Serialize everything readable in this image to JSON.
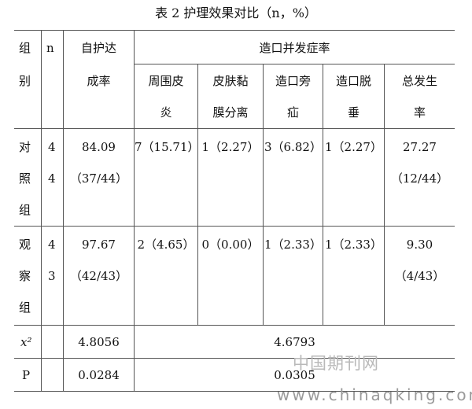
{
  "caption": "表 2 护理效果对比（n，%）",
  "header": {
    "group": [
      "组",
      "别"
    ],
    "n": "n",
    "self_care": [
      "自护达",
      "成率"
    ],
    "complication_group": "造口并发症率",
    "sub": [
      [
        "周围皮",
        "炎"
      ],
      [
        "皮肤黏",
        "膜分离"
      ],
      [
        "造口旁",
        "疝"
      ],
      [
        "造口脱",
        "垂"
      ],
      [
        "总发生",
        "率"
      ]
    ]
  },
  "rows": [
    {
      "group": [
        "对",
        "照",
        "组"
      ],
      "n": [
        "4",
        "4"
      ],
      "self_care": [
        "84.09",
        "（37/44）"
      ],
      "c1": "7（15.71）",
      "c2": "1（2.27）",
      "c3": "3（6.82）",
      "c4": "1（2.27）",
      "total": [
        "27.27",
        "（12/44）"
      ]
    },
    {
      "group": [
        "观",
        "察",
        "组"
      ],
      "n": [
        "4",
        "3"
      ],
      "self_care": [
        "97.67",
        "（42/43）"
      ],
      "c1": "2（4.65）",
      "c2": "0（0.00）",
      "c3": "1（2.33）",
      "c4": "1（2.33）",
      "total": [
        "9.30",
        "（4/43）"
      ]
    }
  ],
  "chi_row": {
    "label": "x²",
    "self_care": "4.8056",
    "complication": "4.6793"
  },
  "p_row": {
    "label": "P",
    "self_care": "0.0284",
    "complication": "0.0305"
  },
  "watermark": {
    "cn": "中国期刊网",
    "url": "www.chinaqking.com"
  }
}
